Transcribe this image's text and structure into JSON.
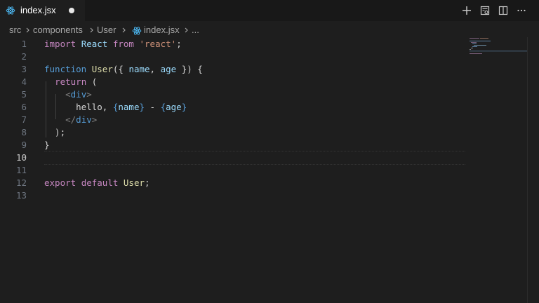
{
  "tab": {
    "title": "index.jsx",
    "dirty": true
  },
  "actions": [
    {
      "name": "new-file-icon"
    },
    {
      "name": "open-preview-icon"
    },
    {
      "name": "split-editor-icon"
    },
    {
      "name": "more-actions-icon"
    }
  ],
  "breadcrumb": {
    "items": [
      "src",
      "components",
      "User",
      "index.jsx",
      "..."
    ]
  },
  "editor": {
    "active_line": 10,
    "lines": [
      {
        "n": "1",
        "tokens": [
          [
            "kw",
            "import"
          ],
          [
            "txt",
            " "
          ],
          [
            "var",
            "React"
          ],
          [
            "txt",
            " "
          ],
          [
            "kw",
            "from"
          ],
          [
            "txt",
            " "
          ],
          [
            "str",
            "'react'"
          ],
          [
            "txt",
            ";"
          ]
        ]
      },
      {
        "n": "2",
        "tokens": []
      },
      {
        "n": "3",
        "tokens": [
          [
            "kw2",
            "function"
          ],
          [
            "txt",
            " "
          ],
          [
            "fn",
            "User"
          ],
          [
            "txt",
            "({ "
          ],
          [
            "var",
            "name"
          ],
          [
            "txt",
            ", "
          ],
          [
            "var",
            "age"
          ],
          [
            "txt",
            " }) {"
          ]
        ]
      },
      {
        "n": "4",
        "tokens": [
          [
            "txt",
            "  "
          ],
          [
            "kw",
            "return"
          ],
          [
            "txt",
            " ("
          ]
        ]
      },
      {
        "n": "5",
        "tokens": [
          [
            "txt",
            "    "
          ],
          [
            "br",
            "<"
          ],
          [
            "tag",
            "div"
          ],
          [
            "br",
            ">"
          ]
        ]
      },
      {
        "n": "6",
        "tokens": [
          [
            "txt",
            "      hello, "
          ],
          [
            "kw2",
            "{"
          ],
          [
            "var",
            "name"
          ],
          [
            "kw2",
            "}"
          ],
          [
            "txt",
            " - "
          ],
          [
            "kw2",
            "{"
          ],
          [
            "var",
            "age"
          ],
          [
            "kw2",
            "}"
          ]
        ]
      },
      {
        "n": "7",
        "tokens": [
          [
            "txt",
            "    "
          ],
          [
            "br",
            "</"
          ],
          [
            "tag",
            "div"
          ],
          [
            "br",
            ">"
          ]
        ]
      },
      {
        "n": "8",
        "tokens": [
          [
            "txt",
            "  );"
          ]
        ]
      },
      {
        "n": "9",
        "tokens": [
          [
            "txt",
            "}"
          ]
        ]
      },
      {
        "n": "10",
        "tokens": []
      },
      {
        "n": "11",
        "tokens": []
      },
      {
        "n": "12",
        "tokens": [
          [
            "kw",
            "export"
          ],
          [
            "txt",
            " "
          ],
          [
            "kw",
            "default"
          ],
          [
            "txt",
            " "
          ],
          [
            "fn",
            "User"
          ],
          [
            "txt",
            ";"
          ]
        ]
      },
      {
        "n": "13",
        "tokens": []
      }
    ]
  },
  "colors": {
    "background": "#1e1e1e",
    "keyword": "#c586c0",
    "function": "#dcdcaa",
    "variable": "#9cdcfe",
    "string": "#ce9178",
    "react_icon": "#4fc1ff"
  }
}
